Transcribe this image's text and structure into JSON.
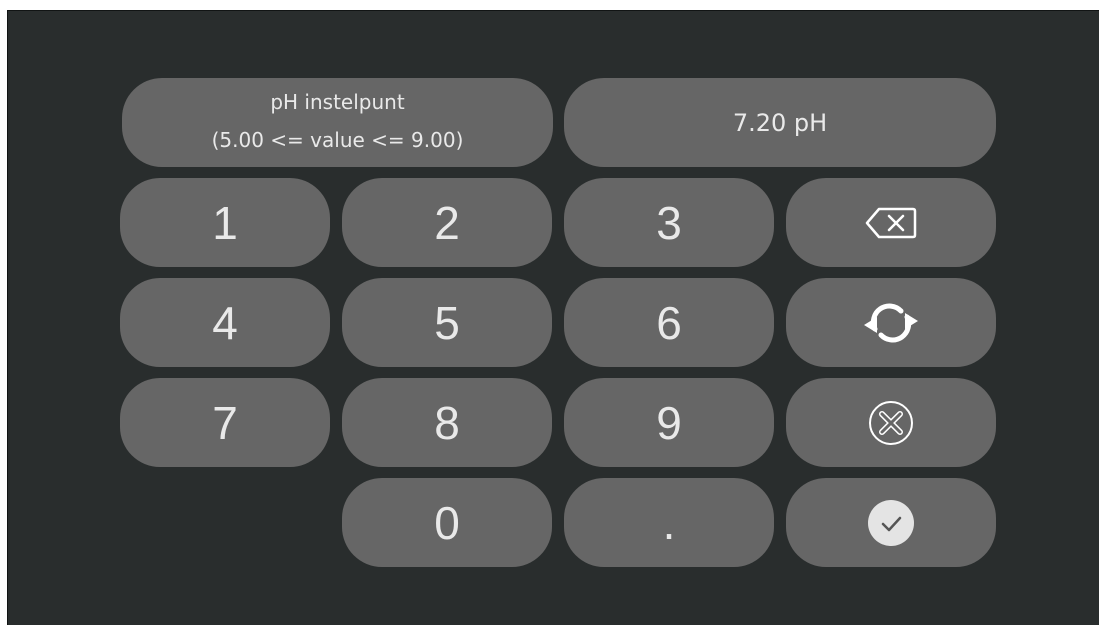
{
  "header": {
    "title": "pH instelpunt",
    "range": "(5.00 <= value <= 9.00)",
    "value": "7.20 pH"
  },
  "keys": {
    "k1": "1",
    "k2": "2",
    "k3": "3",
    "k4": "4",
    "k5": "5",
    "k6": "6",
    "k7": "7",
    "k8": "8",
    "k9": "9",
    "k0": "0",
    "dot": "."
  },
  "icons": {
    "backspace": "backspace-icon",
    "reset": "refresh-icon",
    "cancel": "cancel-icon",
    "confirm": "checkmark-icon"
  },
  "colors": {
    "background": "#292d2d",
    "button": "#666666",
    "text": "#e9e9e9",
    "confirm_circle": "#e4e4e4"
  }
}
